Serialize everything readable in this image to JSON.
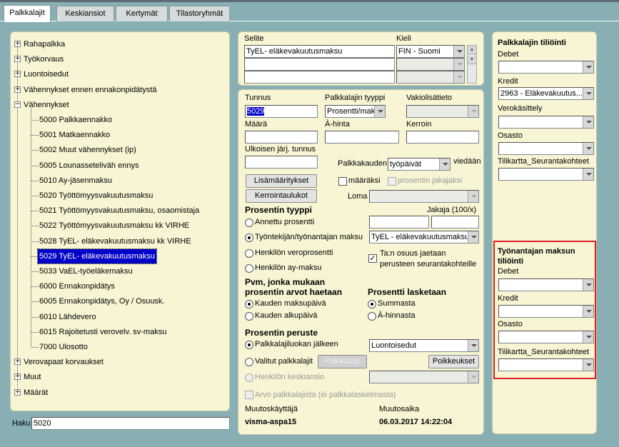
{
  "tabs": [
    "Palkkalajit",
    "Keskiansiot",
    "Kertymät",
    "Tilastoryhmät"
  ],
  "tree": {
    "groups_top": [
      "Rahapalkka",
      "Työkorvaus",
      "Luontoisedut",
      "Vähennykset ennen ennakonpidätystä",
      "Vähennykset"
    ],
    "children": [
      "5000 Palkkaennakko",
      "5001 Matkaennakko",
      "5002 Muut vähennykset (ip)",
      "5005 Lounasseteliväh ennys",
      "5010 Ay-jäsenmaksu",
      "5020 Työttömyysvakuutusmaksu",
      "5021 Työttömyysvakuutusmaksu, osaomistaja",
      "5022 Työttömyysvakuutusmaksu kk VIRHE",
      "5028 TyEL- eläkevakuutusmaksu kk VIRHE",
      "5029 TyEL- eläkevakuutusmaksu",
      "5033 VaEL-työeläkemaksu",
      "6000 Ennakonpidätys",
      "6005 Ennakonpidätys, Oy / Osuusk.",
      "6010 Lähdevero",
      "6015 Rajoitetusti verovelv. sv-maksu",
      "7000 Ulosotto"
    ],
    "selected_index": 9,
    "groups_bottom": [
      "Verovapaat korvaukset",
      "Muut",
      "Määrät"
    ]
  },
  "search": {
    "label": "Haku",
    "value": "5020"
  },
  "desc": {
    "selite_label": "Selite",
    "kieli_label": "Kieli",
    "selite_value": "TyEL- eläkevakuutusmaksu",
    "kieli_value": "FIN - Suomi"
  },
  "form": {
    "tunnus_label": "Tunnus",
    "tunnus_value": "5029",
    "tyyppi_label": "Palkkalajin tyyppi",
    "tyyppi_value": "Prosentti/maksu",
    "vakio_label": "Vakiolisätieto",
    "maara_label": "Määrä",
    "ahinta_label": "À-hinta",
    "kerroin_label": "Kerroin",
    "ulkoinen_label": "Ulkoisen järj. tunnus",
    "kausi_label": "Palkkakauden",
    "kausi_value": "työpäivät",
    "viedaan_label": "viedään",
    "lisa_button": "Lisämääritykset",
    "kerroin_button": "Kerrointaulukot",
    "maaraksi_label": "määräksi",
    "jakajaksi_label": "prosentin jakajaksi",
    "loma_label": "Loma",
    "prosentin_tyyppi_title": "Prosentin tyyppi",
    "jakaja_label": "Jakaja (100/x)",
    "radio_annettu": "Annettu prosentti",
    "radio_tyontekijan": "Työntekijän/työnantajan maksu",
    "tyontekijan_value": "TyEL - eläkevakuutusmaksu",
    "radio_veroprosentti": "Henkilön veroprosentti",
    "radio_ay": "Henkilön ay-maksu",
    "osuus_label_1": "Ta:n osuus jaetaan",
    "osuus_label_2": "perusteen seurantakohteille",
    "pvm_title_1": "Pvm, jonka mukaan",
    "pvm_title_2": "prosentin arvot haetaan",
    "radio_maksupaiva": "Kauden maksupäivä",
    "radio_alkupaiva": "Kauden alkupäivä",
    "prosentti_lasketaan_title": "Prosentti lasketaan",
    "radio_summasta": "Summasta",
    "radio_ahinnasta": "À-hinnasta",
    "peruste_title": "Prosentin peruste",
    "radio_palkkalajiluokan": "Palkkalajiluokan jälkeen",
    "palkkalajiluokan_value": "Luontoisedut",
    "radio_valitut": "Valitut palkkalajit",
    "palkkalajit_button": "Palkkalajit",
    "poikkeukset_button": "Poikkeukset",
    "radio_keskiansio": "Henkilön keskiansio",
    "arvo_label": "Arvo palkkalajista (ei palkkalaskelmasta)",
    "muutoskayttaja_label": "Muutoskäyttäjä",
    "muutosaika_label": "Muutosaika",
    "muutoskayttaja_value": "visma-aspa15",
    "muutosaika_value": "06.03.2017 14:22:04"
  },
  "accounting": {
    "title": "Palkkalajin tiliöinti",
    "debet_label": "Debet",
    "kredit_label": "Kredit",
    "kredit_value": "2963 - Eläkevakuutus...",
    "vero_label": "Verokäsittely",
    "osasto_label": "Osasto",
    "tilikartta_label": "Tilikartta_Seurantakohteet",
    "employer_title_1": "Työnantajan maksun",
    "employer_title_2": "tiliöinti",
    "e_debet_label": "Debet",
    "e_kredit_label": "Kredit",
    "e_osasto_label": "Osasto",
    "e_tilikartta_label": "Tilikartta_Seurantakohteet"
  },
  "colors": {
    "background": "#88b0b4",
    "panel": "#f7f5d4",
    "selection": "#0000c8",
    "highlight_box": "#e02020"
  }
}
